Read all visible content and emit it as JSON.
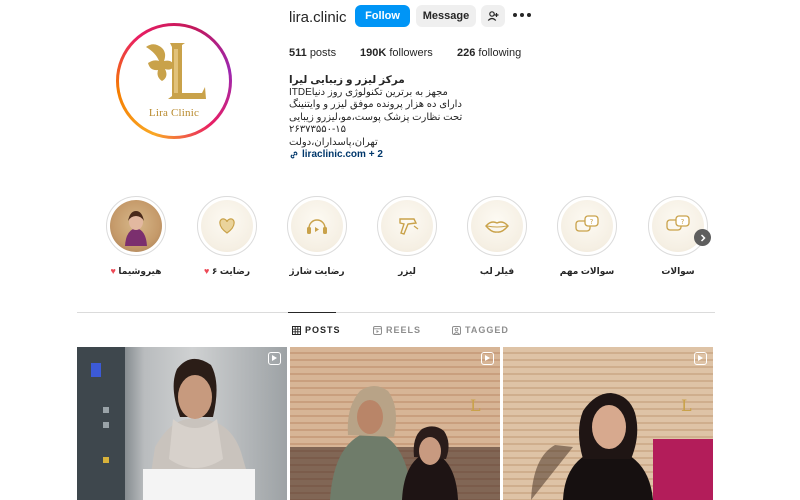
{
  "profile": {
    "username": "lira.clinic",
    "avatar_caption": "Lira Clinic",
    "buttons": {
      "follow": "Follow",
      "message": "Message"
    },
    "stats": {
      "posts_count": "511",
      "posts_label": "posts",
      "followers_count": "190K",
      "followers_label": "followers",
      "following_count": "226",
      "following_label": "following"
    },
    "bio": {
      "name": "مرکز لیزر و زیبایی لیرا",
      "lines": [
        "مجهز به برترین تکنولوژی روز دنیاITDE",
        "دارای ده هزار پرونده موفق لیزر و وایتنینگ",
        "تحت نظارت پزشک پوست،مو،لیزرو زیبایی",
        "۲۶۳۷۳۵۵۰-۱۵",
        "تهران،پاسداران،دولت"
      ],
      "link": "liraclinic.com + 2"
    }
  },
  "highlights": [
    {
      "label": "سوالات",
      "icon": "chat-bubbles-icon"
    },
    {
      "label": "سوالات مهم",
      "icon": "chat-bubbles-icon"
    },
    {
      "label": "فیلر لب",
      "icon": "lips-icon"
    },
    {
      "label": "لیزر",
      "icon": "laser-device-icon"
    },
    {
      "label": "رضایت شارژ",
      "icon": "headset-icon"
    },
    {
      "label": "رضایت ۶",
      "icon": "heart-hands-icon"
    },
    {
      "label": "هیروشیما",
      "icon": "profile-photo-icon"
    }
  ],
  "tabs": {
    "posts": "POSTS",
    "reels": "REELS",
    "tagged": "TAGGED"
  },
  "colors": {
    "accent": "#0095f6",
    "gold": "#b8892b",
    "heart": "#ed4956"
  }
}
